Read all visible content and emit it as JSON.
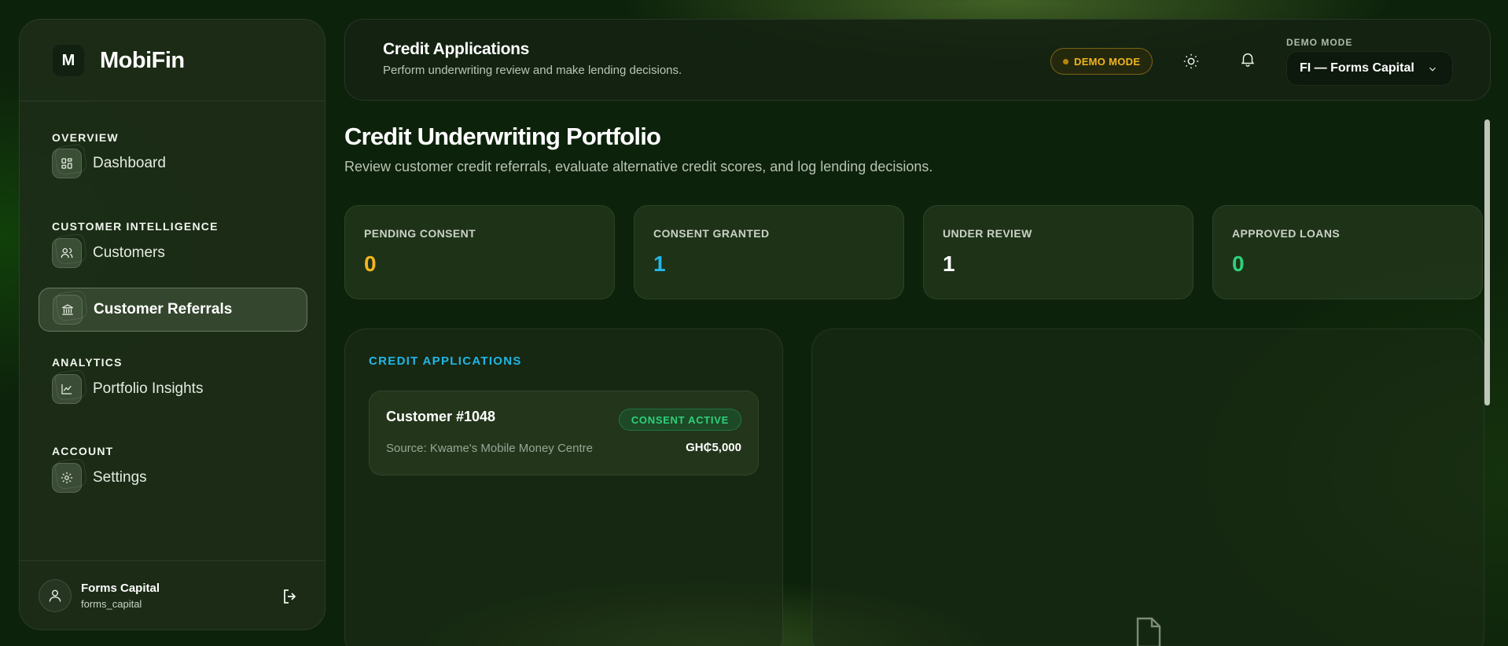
{
  "sidebar": {
    "brand": {
      "logo_letter": "M",
      "name": "MobiFin"
    },
    "sections": [
      {
        "label": "OVERVIEW",
        "items": [
          {
            "label": "Dashboard",
            "icon": "dashboard-icon"
          }
        ]
      },
      {
        "label": "CUSTOMER INTELLIGENCE",
        "items": [
          {
            "label": "Customers",
            "icon": "users-icon"
          },
          {
            "label": "Customer Referrals",
            "icon": "bank-icon",
            "active": true
          }
        ]
      },
      {
        "label": "ANALYTICS",
        "items": [
          {
            "label": "Portfolio Insights",
            "icon": "chart-icon"
          }
        ]
      },
      {
        "label": "ACCOUNT",
        "items": [
          {
            "label": "Settings",
            "icon": "gear-icon"
          }
        ]
      }
    ],
    "user": {
      "name": "Forms Capital",
      "handle": "forms_capital"
    }
  },
  "header": {
    "title": "Credit Applications",
    "subtitle": "Perform underwriting review and make lending decisions.",
    "demo_badge": "DEMO MODE",
    "org_label": "DEMO MODE",
    "org_value": "FI — Forms Capital"
  },
  "main": {
    "title": "Credit Underwriting Portfolio",
    "subtitle": "Review customer credit referrals, evaluate alternative credit scores, and log lending decisions.",
    "stats": [
      {
        "label": "PENDING CONSENT",
        "value": "0",
        "color": "#f2b51f"
      },
      {
        "label": "CONSENT GRANTED",
        "value": "1",
        "color": "#22b6e8"
      },
      {
        "label": "UNDER REVIEW",
        "value": "1",
        "color": "#ffffff"
      },
      {
        "label": "APPROVED LOANS",
        "value": "0",
        "color": "#2fd07a"
      }
    ],
    "applications": {
      "heading": "CREDIT APPLICATIONS",
      "items": [
        {
          "name": "Customer #1048",
          "status": "CONSENT ACTIVE",
          "source": "Source: Kwame's Mobile Money Centre",
          "amount": "GH₵5,000"
        }
      ]
    }
  }
}
